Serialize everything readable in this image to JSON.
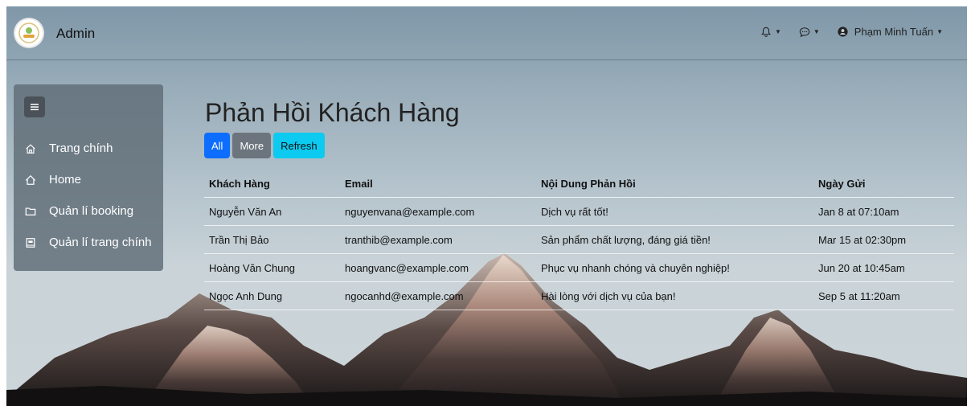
{
  "header": {
    "brand": "Admin",
    "user_name": "Phạm Minh Tuấn"
  },
  "sidebar": {
    "items": [
      {
        "label": "Trang chính",
        "icon": "home-outline-icon"
      },
      {
        "label": "Home",
        "icon": "house-icon"
      },
      {
        "label": "Quản lí booking",
        "icon": "folder-icon"
      },
      {
        "label": "Quản lí trang chính",
        "icon": "book-icon"
      }
    ]
  },
  "main": {
    "title": "Phản Hồi Khách Hàng",
    "buttons": {
      "all": "All",
      "more": "More",
      "refresh": "Refresh"
    },
    "table": {
      "headers": [
        "Khách Hàng",
        "Email",
        "Nội Dung Phản Hồi",
        "Ngày Gửi"
      ],
      "rows": [
        [
          "Nguyễn Văn An",
          "nguyenvana@example.com",
          "Dịch vụ rất tốt!",
          "Jan 8 at 07:10am"
        ],
        [
          "Trần Thị Bảo",
          "tranthib@example.com",
          "Sản phẩm chất lượng, đáng giá tiền!",
          "Mar 15 at 02:30pm"
        ],
        [
          "Hoàng Văn Chung",
          "hoangvanc@example.com",
          "Phục vụ nhanh chóng và chuyên nghiệp!",
          "Jun 20 at 10:45am"
        ],
        [
          "Ngọc Anh Dung",
          "ngocanhd@example.com",
          "Hài lòng với dịch vụ của bạn!",
          "Sep 5 at 11:20am"
        ]
      ]
    }
  },
  "colors": {
    "primary": "#0d6efd",
    "secondary": "#6c757d",
    "info": "#0dcaf0",
    "sidebar_bg": "#5f6c76"
  }
}
